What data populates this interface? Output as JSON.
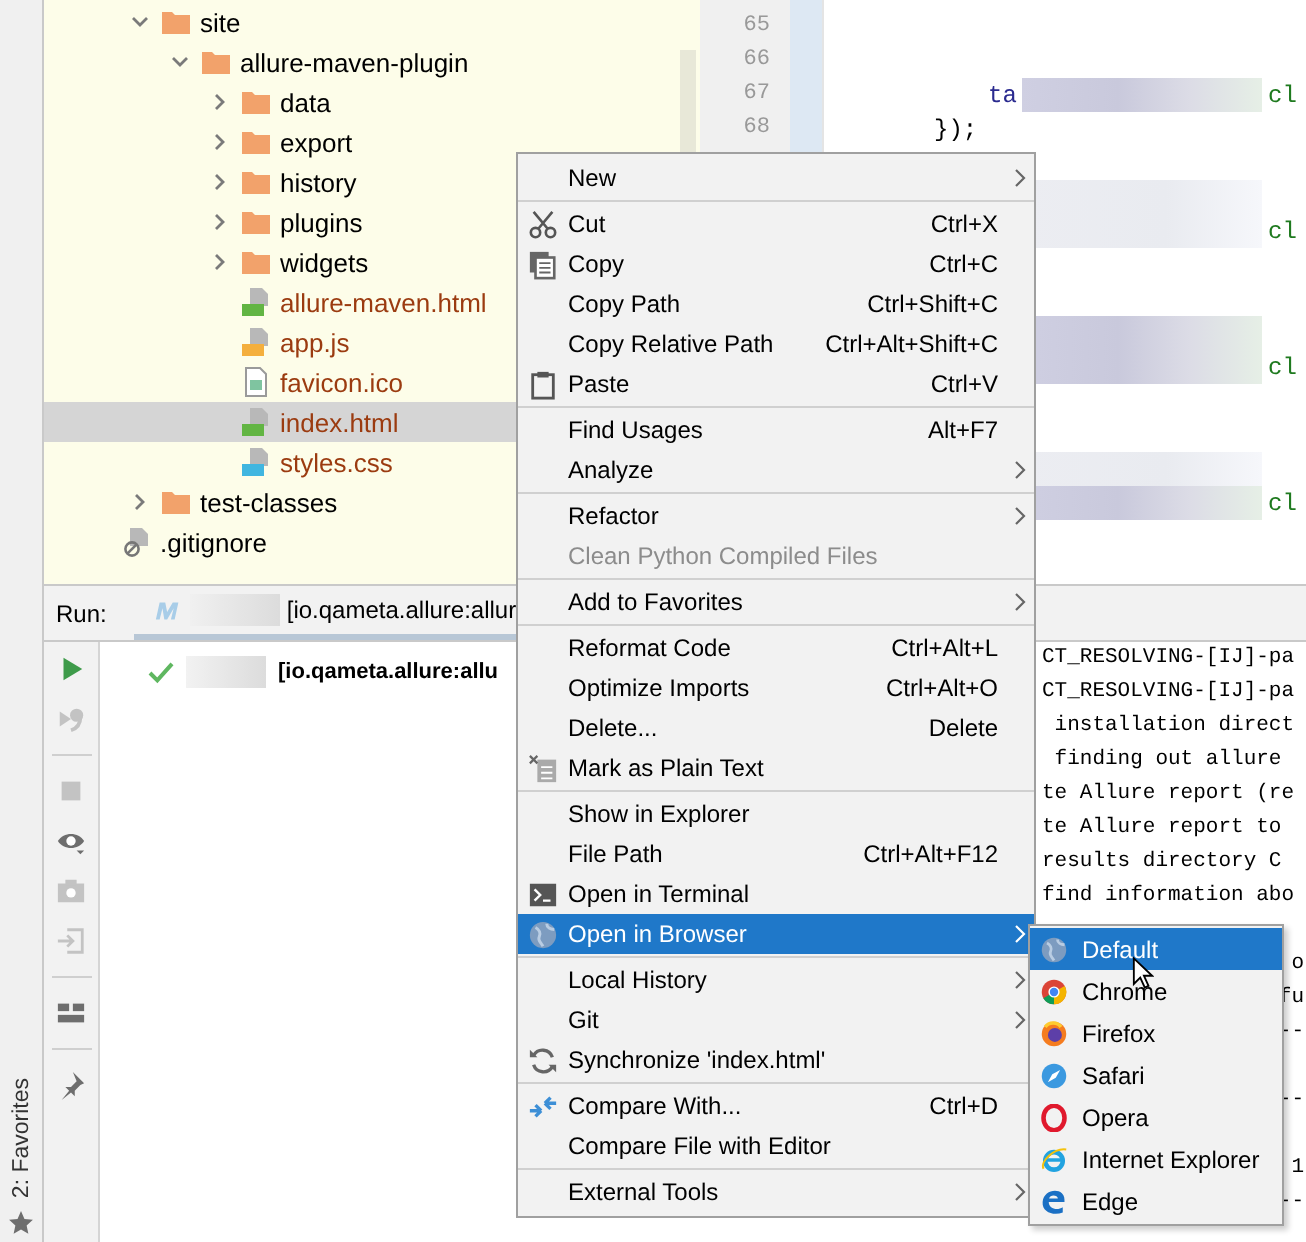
{
  "favorites_bar": {
    "label": "2: Favorites"
  },
  "project_tree": {
    "items": [
      {
        "name": "site",
        "kind": "folder",
        "expanded": true,
        "selected": false,
        "children": [
          {
            "name": "allure-maven-plugin",
            "kind": "folder",
            "expanded": true,
            "selected": false,
            "children": [
              {
                "name": "data",
                "kind": "folder",
                "expanded": false,
                "selected": false
              },
              {
                "name": "export",
                "kind": "folder",
                "expanded": false,
                "selected": false
              },
              {
                "name": "history",
                "kind": "folder",
                "expanded": false,
                "selected": false
              },
              {
                "name": "plugins",
                "kind": "folder",
                "expanded": false,
                "selected": false
              },
              {
                "name": "widgets",
                "kind": "folder",
                "expanded": false,
                "selected": false
              },
              {
                "name": "allure-maven.html",
                "kind": "html",
                "selected": false,
                "color": "#9b3b10"
              },
              {
                "name": "app.js",
                "kind": "js",
                "selected": false,
                "color": "#9b3b10"
              },
              {
                "name": "favicon.ico",
                "kind": "image",
                "selected": false,
                "color": "#9b3b10"
              },
              {
                "name": "index.html",
                "kind": "html",
                "selected": true,
                "color": "#9b3b10"
              },
              {
                "name": "styles.css",
                "kind": "css",
                "selected": false,
                "color": "#9b3b10"
              }
            ]
          }
        ]
      },
      {
        "name": "test-classes",
        "kind": "folder",
        "expanded": false,
        "selected": false
      }
    ],
    "outer_items": [
      {
        "name": ".gitignore",
        "kind": "gitignore",
        "selected": false
      }
    ]
  },
  "editor": {
    "lines": [
      {
        "kind": "blank",
        "number": "65"
      },
      {
        "kind": "blank",
        "number": "66"
      },
      {
        "kind": "blurred",
        "number": "67",
        "code": "ta",
        "tail": "cl"
      },
      {
        "kind": "code",
        "number": "68",
        "code": "});"
      },
      {
        "kind": "blank"
      },
      {
        "kind": "faint"
      },
      {
        "kind": "faint",
        "tail": "cl"
      },
      {
        "kind": "blank"
      },
      {
        "kind": "blank"
      },
      {
        "kind": "blurred"
      },
      {
        "kind": "blurred",
        "tail": "cl"
      },
      {
        "kind": "blank"
      },
      {
        "kind": "blank"
      },
      {
        "kind": "faint"
      },
      {
        "kind": "blurred",
        "tail": "cl"
      }
    ]
  },
  "run_panel": {
    "label": "Run:",
    "tab": {
      "text": "[io.qameta.allure:allur"
    },
    "result": {
      "text": "[io.qameta.allure:allu",
      "passed": true
    }
  },
  "console": {
    "lines": [
      {
        "kind": "text",
        "text": "CT_RESOLVING-[IJ]-pa"
      },
      {
        "kind": "text",
        "text": "CT_RESOLVING-[IJ]-pa"
      },
      {
        "kind": "text",
        "text": " installation direct"
      },
      {
        "kind": "text",
        "text": " finding out allure"
      },
      {
        "kind": "text",
        "text": "te Allure report (re"
      },
      {
        "kind": "text",
        "text": "te Allure report to"
      },
      {
        "kind": "text",
        "text": "results directory C"
      },
      {
        "kind": "text",
        "text": "find information abo"
      },
      {
        "kind": "blank"
      },
      {
        "kind": "tail",
        "text": "o"
      },
      {
        "kind": "tail",
        "text": "fu"
      },
      {
        "kind": "tail",
        "text": "--"
      },
      {
        "kind": "blank"
      },
      {
        "kind": "tail",
        "text": "--"
      },
      {
        "kind": "blank"
      },
      {
        "kind": "tail",
        "text": "1"
      },
      {
        "kind": "tail",
        "text": "--"
      }
    ]
  },
  "context_menu": {
    "items": [
      {
        "kind": "plain",
        "label": "New",
        "submenu": true,
        "disabled": false,
        "selected": false
      },
      {
        "kind": "separator"
      },
      {
        "kind": "scissors",
        "label": "Cut",
        "shortcut": "Ctrl+X",
        "submenu": false,
        "disabled": false,
        "selected": false
      },
      {
        "kind": "copy",
        "label": "Copy",
        "shortcut": "Ctrl+C",
        "submenu": false,
        "disabled": false,
        "selected": false
      },
      {
        "kind": "plain",
        "label": "Copy Path",
        "shortcut": "Ctrl+Shift+C",
        "submenu": false,
        "disabled": false,
        "selected": false
      },
      {
        "kind": "plain",
        "label": "Copy Relative Path",
        "shortcut": "Ctrl+Alt+Shift+C",
        "submenu": false,
        "disabled": false,
        "selected": false
      },
      {
        "kind": "paste",
        "label": "Paste",
        "shortcut": "Ctrl+V",
        "submenu": false,
        "disabled": false,
        "selected": false
      },
      {
        "kind": "separator"
      },
      {
        "kind": "plain",
        "label": "Find Usages",
        "shortcut": "Alt+F7",
        "submenu": false,
        "disabled": false,
        "selected": false
      },
      {
        "kind": "plain",
        "label": "Analyze",
        "submenu": true,
        "disabled": false,
        "selected": false
      },
      {
        "kind": "separator"
      },
      {
        "kind": "plain",
        "label": "Refactor",
        "submenu": true,
        "disabled": false,
        "selected": false
      },
      {
        "kind": "plain",
        "label": "Clean Python Compiled Files",
        "submenu": false,
        "disabled": true,
        "selected": false
      },
      {
        "kind": "separator"
      },
      {
        "kind": "plain",
        "label": "Add to Favorites",
        "submenu": true,
        "disabled": false,
        "selected": false
      },
      {
        "kind": "separator"
      },
      {
        "kind": "plain",
        "label": "Reformat Code",
        "shortcut": "Ctrl+Alt+L",
        "submenu": false,
        "disabled": false,
        "selected": false
      },
      {
        "kind": "plain",
        "label": "Optimize Imports",
        "shortcut": "Ctrl+Alt+O",
        "submenu": false,
        "disabled": false,
        "selected": false
      },
      {
        "kind": "plain",
        "label": "Delete...",
        "shortcut": "Delete",
        "submenu": false,
        "disabled": false,
        "selected": false
      },
      {
        "kind": "plaintext",
        "label": "Mark as Plain Text",
        "submenu": false,
        "disabled": false,
        "selected": false
      },
      {
        "kind": "separator"
      },
      {
        "kind": "plain",
        "label": "Show in Explorer",
        "submenu": false,
        "disabled": false,
        "selected": false
      },
      {
        "kind": "plain",
        "label": "File Path",
        "shortcut": "Ctrl+Alt+F12",
        "submenu": false,
        "disabled": false,
        "selected": false
      },
      {
        "kind": "terminal",
        "label": "Open in Terminal",
        "submenu": false,
        "disabled": false,
        "selected": false
      },
      {
        "kind": "globe",
        "label": "Open in Browser",
        "submenu": true,
        "disabled": false,
        "selected": true
      },
      {
        "kind": "separator"
      },
      {
        "kind": "plain",
        "label": "Local History",
        "submenu": true,
        "disabled": false,
        "selected": false
      },
      {
        "kind": "plain",
        "label": "Git",
        "submenu": true,
        "disabled": false,
        "selected": false
      },
      {
        "kind": "sync",
        "label": "Synchronize 'index.html'",
        "submenu": false,
        "disabled": false,
        "selected": false
      },
      {
        "kind": "separator"
      },
      {
        "kind": "compare",
        "label": "Compare With...",
        "shortcut": "Ctrl+D",
        "submenu": false,
        "disabled": false,
        "selected": false
      },
      {
        "kind": "plain",
        "label": "Compare File with Editor",
        "submenu": false,
        "disabled": false,
        "selected": false
      },
      {
        "kind": "separator"
      },
      {
        "kind": "plain",
        "label": "External Tools",
        "submenu": true,
        "disabled": false,
        "selected": false
      }
    ]
  },
  "browser_submenu": {
    "items": [
      {
        "kind": "default",
        "label": "Default",
        "selected": true
      },
      {
        "kind": "chrome",
        "label": "Chrome",
        "selected": false
      },
      {
        "kind": "firefox",
        "label": "Firefox",
        "selected": false
      },
      {
        "kind": "safari",
        "label": "Safari",
        "selected": false
      },
      {
        "kind": "opera",
        "label": "Opera",
        "selected": false
      },
      {
        "kind": "ie",
        "label": "Internet Explorer",
        "selected": false
      },
      {
        "kind": "edge",
        "label": "Edge",
        "selected": false
      }
    ]
  }
}
